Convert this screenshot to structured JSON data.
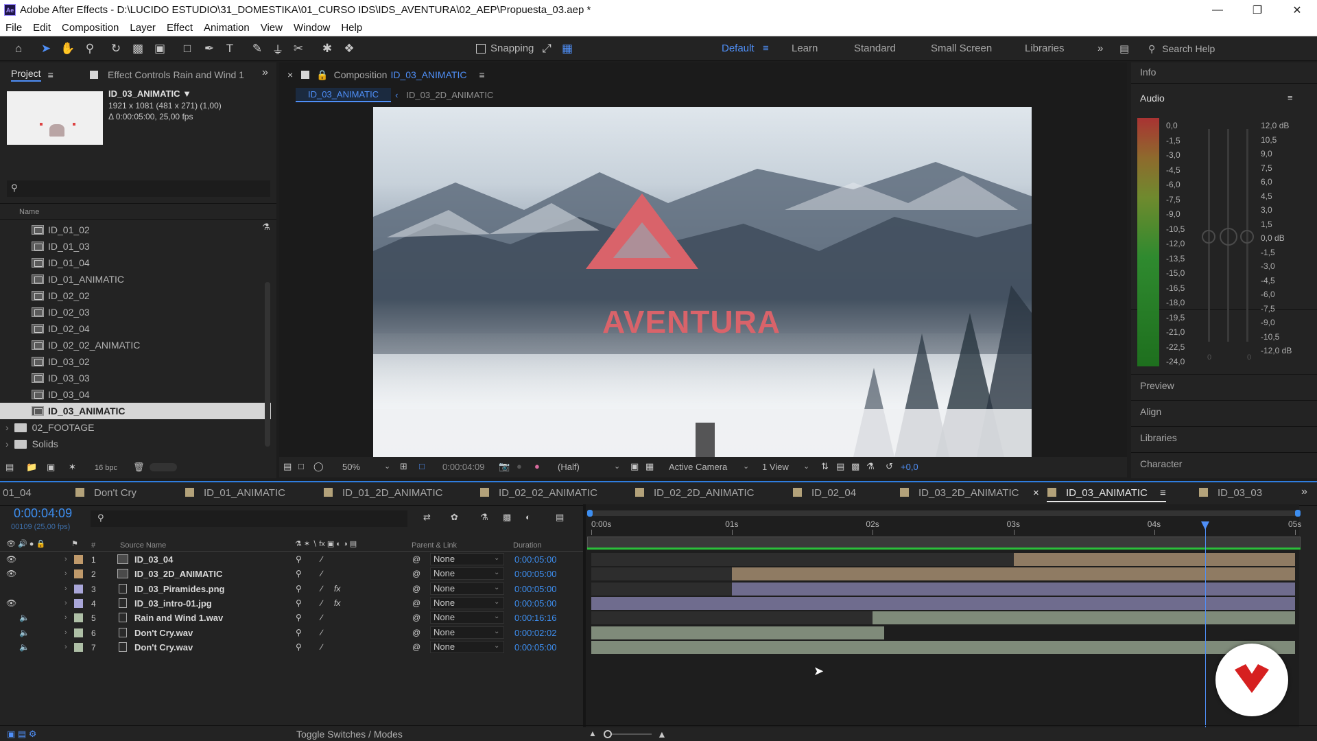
{
  "window": {
    "title": "Adobe After Effects - D:\\LUCIDO ESTUDIO\\31_DOMESTIKA\\01_CURSO IDS\\IDS_AVENTURA\\02_AEP\\Propuesta_03.aep *",
    "app_badge": "Ae"
  },
  "menu": [
    "File",
    "Edit",
    "Composition",
    "Layer",
    "Effect",
    "Animation",
    "View",
    "Window",
    "Help"
  ],
  "toolbar": {
    "snapping": "Snapping",
    "workspaces": [
      "Default",
      "Learn",
      "Standard",
      "Small Screen",
      "Libraries"
    ],
    "active_workspace": "Default",
    "search_placeholder": "Search Help"
  },
  "project_panel": {
    "tab_project": "Project",
    "tab_effect_controls": "Effect Controls Rain and Wind 1",
    "selected_name": "ID_03_ANIMATIC ▼",
    "selected_dims": "1921 x 1081  (481 x 271) (1,00)",
    "selected_duration": "Δ 0:00:05:00, 25,00 fps",
    "column_name": "Name",
    "items": [
      {
        "name": "ID_01_02",
        "type": "comp"
      },
      {
        "name": "ID_01_03",
        "type": "comp"
      },
      {
        "name": "ID_01_04",
        "type": "comp"
      },
      {
        "name": "ID_01_ANIMATIC",
        "type": "comp"
      },
      {
        "name": "ID_02_02",
        "type": "comp"
      },
      {
        "name": "ID_02_03",
        "type": "comp"
      },
      {
        "name": "ID_02_04",
        "type": "comp"
      },
      {
        "name": "ID_02_02_ANIMATIC",
        "type": "comp"
      },
      {
        "name": "ID_03_02",
        "type": "comp"
      },
      {
        "name": "ID_03_03",
        "type": "comp"
      },
      {
        "name": "ID_03_04",
        "type": "comp"
      },
      {
        "name": "ID_03_ANIMATIC",
        "type": "comp",
        "selected": true
      },
      {
        "name": "02_FOOTAGE",
        "type": "folder"
      },
      {
        "name": "Solids",
        "type": "folder"
      }
    ],
    "bpc": "16 bpc"
  },
  "composition_panel": {
    "tab_prefix": "Composition",
    "tab_name": "ID_03_ANIMATIC",
    "crumb_active": "ID_03_ANIMATIC",
    "crumb_other": "ID_03_2D_ANIMATIC",
    "logo_text": "AVENTURA",
    "zoom": "50%",
    "timecode": "0:00:04:09",
    "resolution": "(Half)",
    "camera": "Active Camera",
    "views": "1 View",
    "exposure": "+0,0"
  },
  "right_panels": {
    "info": "Info",
    "audio": "Audio",
    "preview": "Preview",
    "align": "Align",
    "libraries": "Libraries",
    "character": "Character",
    "meter_left": [
      "0,0",
      "-1,5",
      "-3,0",
      "-4,5",
      "-6,0",
      "-7,5",
      "-9,0",
      "-10,5",
      "-12,0",
      "-13,5",
      "-15,0",
      "-16,5",
      "-18,0",
      "-19,5",
      "-21,0",
      "-22,5",
      "-24,0"
    ],
    "meter_right": [
      "12,0 dB",
      "10,5",
      "9,0",
      "7,5",
      "6,0",
      "4,5",
      "3,0",
      "1,5",
      "0,0 dB",
      "-1,5",
      "-3,0",
      "-4,5",
      "-6,0",
      "-7,5",
      "-9,0",
      "-10,5",
      "-12,0 dB"
    ],
    "slider_zero_l": "0",
    "slider_zero_r": "0"
  },
  "timeline": {
    "tabs": [
      {
        "name": "01_04",
        "color": "#b3a27a"
      },
      {
        "name": "Don't Cry",
        "color": "#b3a27a"
      },
      {
        "name": "ID_01_ANIMATIC",
        "color": "#b3a27a"
      },
      {
        "name": "ID_01_2D_ANIMATIC",
        "color": "#b3a27a"
      },
      {
        "name": "ID_02_02_ANIMATIC",
        "color": "#b3a27a"
      },
      {
        "name": "ID_02_2D_ANIMATIC",
        "color": "#b3a27a"
      },
      {
        "name": "ID_02_04",
        "color": "#b3a27a"
      },
      {
        "name": "ID_03_2D_ANIMATIC",
        "color": "#b3a27a"
      },
      {
        "name": "ID_03_ANIMATIC",
        "color": "#b3a27a",
        "active": true
      },
      {
        "name": "ID_03_03",
        "color": "#b3a27a"
      }
    ],
    "current_time": "0:00:04:09",
    "frame_info": "00109 (25,00 fps)",
    "col_source_name": "Source Name",
    "col_parent": "Parent & Link",
    "col_duration": "Duration",
    "ruler": [
      "0:00s",
      "01s",
      "02s",
      "03s",
      "04s",
      "05s"
    ],
    "playhead_seconds": 4.36,
    "duration_seconds": 5,
    "layers": [
      {
        "num": "1",
        "name": "ID_03_04",
        "parent": "None",
        "duration": "0:00:05:00",
        "label": "#c09a6b",
        "bar_color": "#8f7b63",
        "start": 3.0,
        "end": 5.0,
        "visible": true,
        "kind": "comp"
      },
      {
        "num": "2",
        "name": "ID_03_2D_ANIMATIC",
        "parent": "None",
        "duration": "0:00:05:00",
        "label": "#c09a6b",
        "bar_color": "#8f7b63",
        "start": 1.0,
        "end": 5.0,
        "visible": true,
        "kind": "comp"
      },
      {
        "num": "3",
        "name": "ID_03_Piramides.png",
        "parent": "None",
        "duration": "0:00:05:00",
        "label": "#a9a6d9",
        "bar_color": "#6f6c8e",
        "start": 1.0,
        "end": 5.0,
        "visible": false,
        "kind": "image",
        "fx": true
      },
      {
        "num": "4",
        "name": "ID_03_intro-01.jpg",
        "parent": "None",
        "duration": "0:00:05:00",
        "label": "#a9a6d9",
        "bar_color": "#6f6c8e",
        "start": 0.0,
        "end": 5.0,
        "visible": true,
        "kind": "image",
        "fx": true
      },
      {
        "num": "5",
        "name": "Rain and Wind 1.wav",
        "parent": "None",
        "duration": "0:00:16:16",
        "label": "#aebfa6",
        "bar_color": "#7f8b7a",
        "start": 2.0,
        "end": 5.0,
        "visible": false,
        "kind": "audio"
      },
      {
        "num": "6",
        "name": "Don't Cry.wav",
        "parent": "None",
        "duration": "0:00:02:02",
        "label": "#aebfa6",
        "bar_color": "#7f8b7a",
        "start": 0.0,
        "end": 2.08,
        "visible": false,
        "kind": "audio"
      },
      {
        "num": "7",
        "name": "Don't Cry.wav",
        "parent": "None",
        "duration": "0:00:05:00",
        "label": "#aebfa6",
        "bar_color": "#7f8b7a",
        "start": 0.0,
        "end": 5.0,
        "visible": false,
        "kind": "audio"
      }
    ],
    "toggle_label": "Toggle Switches / Modes"
  },
  "colors": {
    "accent_blue": "#3d8ef0",
    "logo_red": "#d9636a",
    "badge_red": "#d62020"
  }
}
